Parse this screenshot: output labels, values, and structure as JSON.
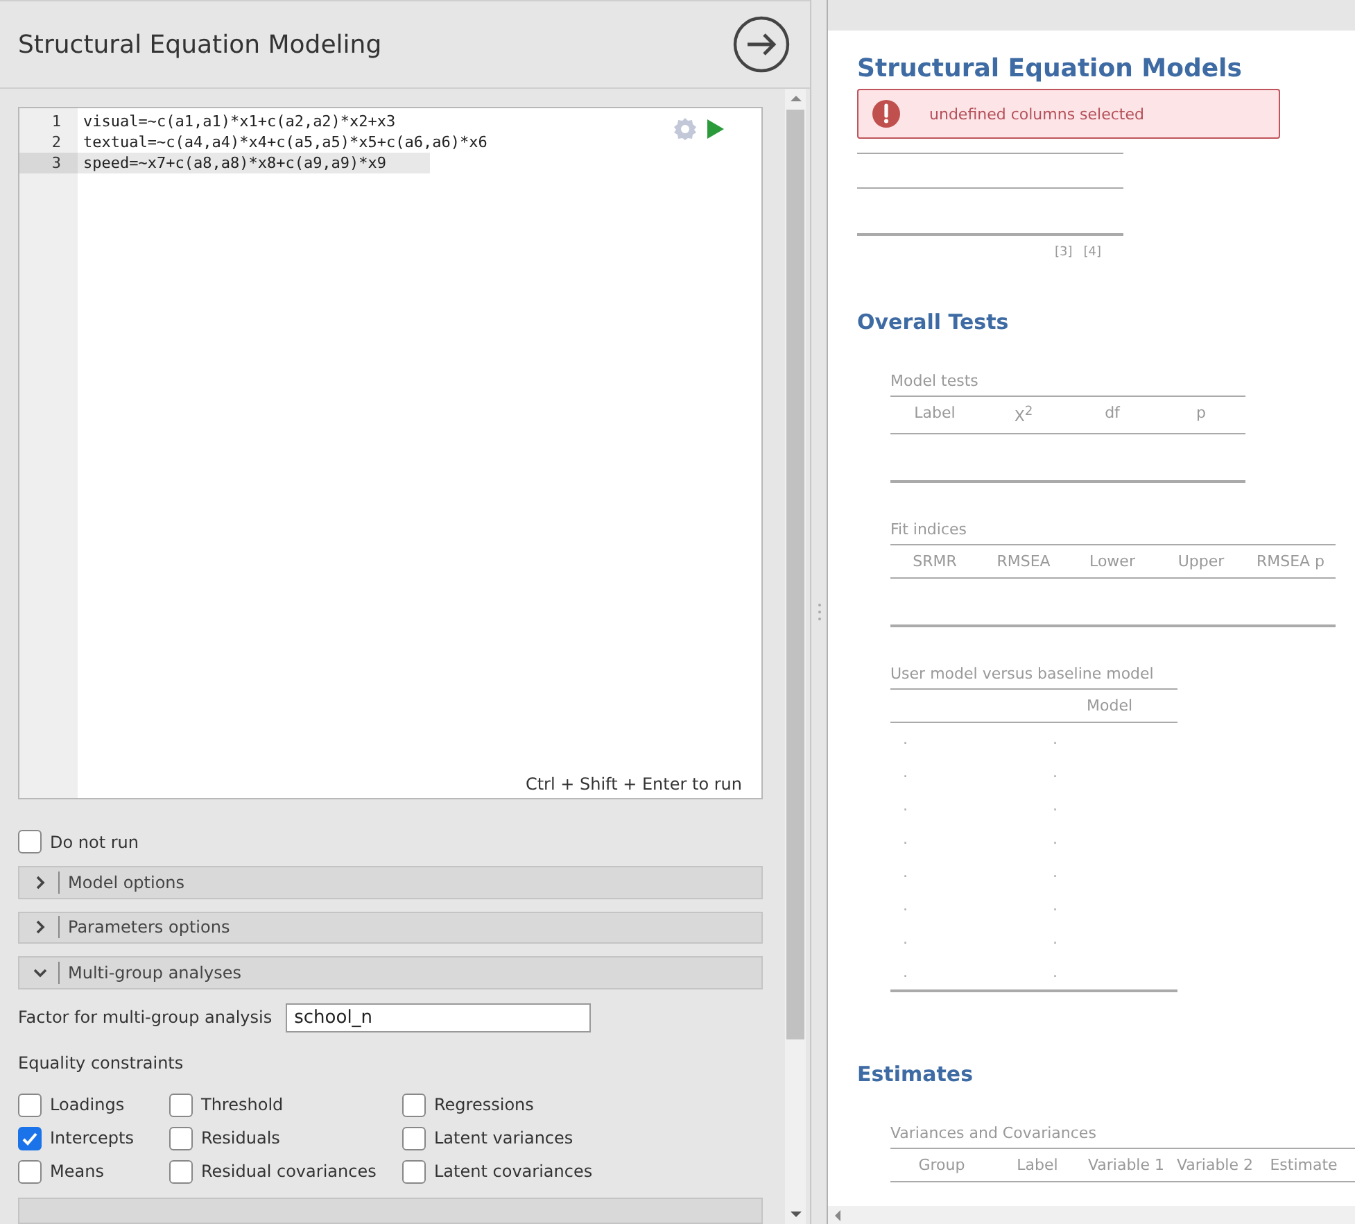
{
  "options_panel": {
    "title": "Structural Equation Modeling",
    "editor": {
      "lines": [
        {
          "number": "1",
          "code": "visual=~c(a1,a1)*x1+c(a2,a2)*x2+x3",
          "selected": false
        },
        {
          "number": "2",
          "code": "textual=~c(a4,a4)*x4+c(a5,a5)*x5+c(a6,a6)*x6",
          "selected": false
        },
        {
          "number": "3",
          "code": "speed=~x7+c(a8,a8)*x8+c(a9,a9)*x9",
          "selected": true
        }
      ],
      "hint": "Ctrl + Shift + Enter to run"
    },
    "do_not_run": {
      "label": "Do not run",
      "checked": false
    },
    "sections": [
      {
        "label": "Model options",
        "expanded": false
      },
      {
        "label": "Parameters options",
        "expanded": false
      },
      {
        "label": "Multi-group analyses",
        "expanded": true
      }
    ],
    "factor": {
      "label": "Factor for multi-group analysis",
      "value": "school_n"
    },
    "equality": {
      "label": "Equality constraints",
      "options": [
        {
          "label": "Loadings",
          "checked": false
        },
        {
          "label": "Threshold",
          "checked": false
        },
        {
          "label": "Regressions",
          "checked": false
        },
        {
          "label": "Intercepts",
          "checked": true
        },
        {
          "label": "Residuals",
          "checked": false
        },
        {
          "label": "Latent variances",
          "checked": false
        },
        {
          "label": "Means",
          "checked": false
        },
        {
          "label": "Residual covariances",
          "checked": false
        },
        {
          "label": "Latent covariances",
          "checked": false
        }
      ]
    }
  },
  "results": {
    "title": "Structural Equation Models",
    "alert": {
      "message": "undefined columns selected"
    },
    "info_notes": [
      "[3]",
      "[4]"
    ],
    "blocks": [
      {
        "kind": "heading",
        "text": "Overall Tests"
      },
      {
        "kind": "table",
        "title": "Model tests",
        "columns": [
          "Label",
          "X$^{2}$",
          "df",
          "p"
        ]
      },
      {
        "kind": "table",
        "title": "Fit indices",
        "columns": [
          "SRMR",
          "RMSEA",
          "Lower",
          "Upper",
          "RMSEA p"
        ]
      },
      {
        "kind": "table",
        "title": "User model versus baseline model",
        "columns": [
          "",
          "Model"
        ],
        "rows": [
          [
            ".",
            "."
          ],
          [
            ".",
            "."
          ],
          [
            ".",
            "."
          ],
          [
            ".",
            "."
          ],
          [
            ".",
            "."
          ],
          [
            ".",
            "."
          ],
          [
            ".",
            "."
          ],
          [
            ".",
            "."
          ]
        ]
      },
      {
        "kind": "heading",
        "text": "Estimates"
      },
      {
        "kind": "table",
        "title": "Variances and Covariances",
        "columns": [
          "Group",
          "Label",
          "Variable 1",
          "Variable 2",
          "Estimate"
        ]
      }
    ]
  }
}
